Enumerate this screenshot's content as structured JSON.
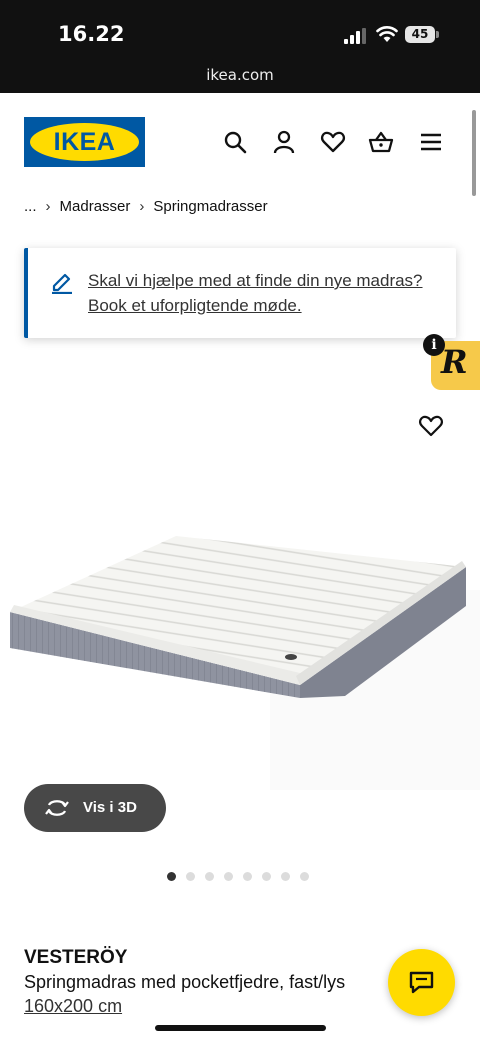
{
  "status_bar": {
    "time": "16.22",
    "battery": "45",
    "url": "ikea.com"
  },
  "header": {
    "logo_text": "IKEA",
    "icons": [
      "search-icon",
      "profile-icon",
      "heart-icon",
      "basket-icon",
      "menu-icon"
    ]
  },
  "breadcrumb": {
    "ellipsis": "...",
    "items": [
      "Madrasser",
      "Springmadrasser"
    ]
  },
  "help_banner": {
    "text": "Skal vi hjælpe med at finde din nye madras? Book et uforpligtende møde."
  },
  "badge": {
    "info": "i",
    "letter": "R"
  },
  "product": {
    "view_3d_label": "Vis i 3D",
    "image_count": 8,
    "active_image": 1,
    "name": "VESTERÖY",
    "description": "Springmadras med pocketfjedre, fast/lys",
    "size": "160x200 cm"
  },
  "colors": {
    "brand_blue": "#0058a3",
    "brand_yellow": "#ffdb00",
    "dark_button": "#484848"
  }
}
